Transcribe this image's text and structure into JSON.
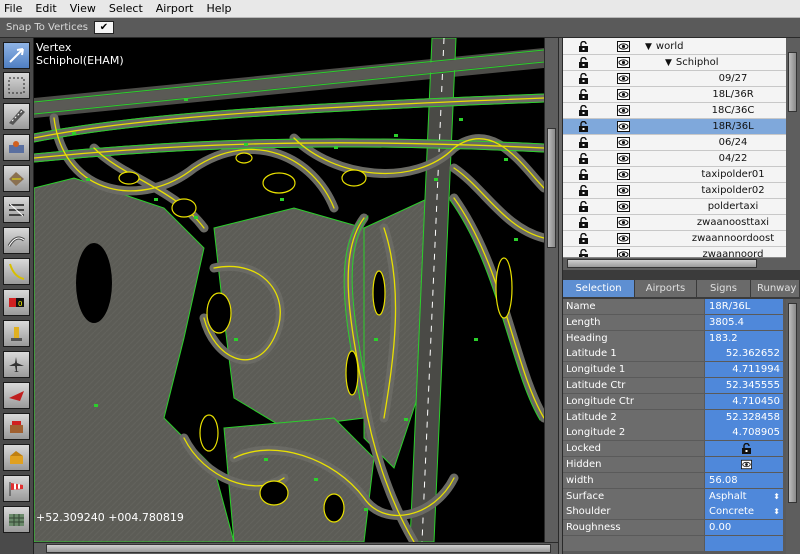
{
  "menu": [
    "File",
    "Edit",
    "View",
    "Select",
    "Airport",
    "Help"
  ],
  "toolbar": {
    "snap_label": "Snap To Vertices",
    "snap_checked": "✔"
  },
  "map": {
    "tool_name": "Vertex",
    "airport": "Schiphol(EHAM)",
    "coords": "+52.309240  +004.780819"
  },
  "hierarchy": {
    "rows": [
      {
        "label": "world",
        "level": 0,
        "expanded": true,
        "selected": false
      },
      {
        "label": "Schiphol",
        "level": 1,
        "expanded": true,
        "selected": false
      },
      {
        "label": "09/27",
        "level": 2,
        "selected": false
      },
      {
        "label": "18L/36R",
        "level": 2,
        "selected": false
      },
      {
        "label": "18C/36C",
        "level": 2,
        "selected": false
      },
      {
        "label": "18R/36L",
        "level": 2,
        "selected": true
      },
      {
        "label": "06/24",
        "level": 2,
        "selected": false
      },
      {
        "label": "04/22",
        "level": 2,
        "selected": false
      },
      {
        "label": "taxipolder01",
        "level": 2,
        "selected": false
      },
      {
        "label": "taxipolder02",
        "level": 2,
        "selected": false
      },
      {
        "label": "poldertaxi",
        "level": 2,
        "selected": false
      },
      {
        "label": "zwaanoosttaxi",
        "level": 2,
        "selected": false
      },
      {
        "label": "zwaannoordoost",
        "level": 2,
        "selected": false
      },
      {
        "label": "zwaannoord",
        "level": 2,
        "selected": false
      }
    ]
  },
  "tabs": [
    "Selection",
    "Airports",
    "Signs",
    "Runway"
  ],
  "properties": [
    {
      "key": "Name",
      "value": "18R/36L",
      "align": "left"
    },
    {
      "key": "Length",
      "value": "3805.4",
      "align": "left"
    },
    {
      "key": "Heading",
      "value": "183.2",
      "align": "left"
    },
    {
      "key": "Latitude 1",
      "value": "52.362652",
      "align": "right"
    },
    {
      "key": "Longitude 1",
      "value": "4.711994",
      "align": "right"
    },
    {
      "key": "Latitude Ctr",
      "value": "52.345555",
      "align": "right"
    },
    {
      "key": "Longitude Ctr",
      "value": "4.710450",
      "align": "right"
    },
    {
      "key": "Latitude 2",
      "value": "52.328458",
      "align": "right"
    },
    {
      "key": "Longitude 2",
      "value": "4.708905",
      "align": "right"
    },
    {
      "key": "Locked",
      "value": "",
      "icon": "lock",
      "align": "left"
    },
    {
      "key": "Hidden",
      "value": "",
      "icon": "eye",
      "align": "left"
    },
    {
      "key": "width",
      "value": "56.08",
      "align": "left"
    },
    {
      "key": "Surface",
      "value": "Asphalt",
      "align": "left",
      "spinner": true
    },
    {
      "key": "Shoulder",
      "value": "Concrete",
      "align": "left",
      "spinner": true
    },
    {
      "key": "Roughness",
      "value": "0.00",
      "align": "left"
    },
    {
      "key": "",
      "value": "",
      "align": "left"
    }
  ],
  "colors": {
    "selection": "#7fa8db",
    "value_bg": "#4f88da",
    "taxi_line": "#e8e000",
    "edge_line": "#2bd02b",
    "pavement": "#5a5a55"
  }
}
